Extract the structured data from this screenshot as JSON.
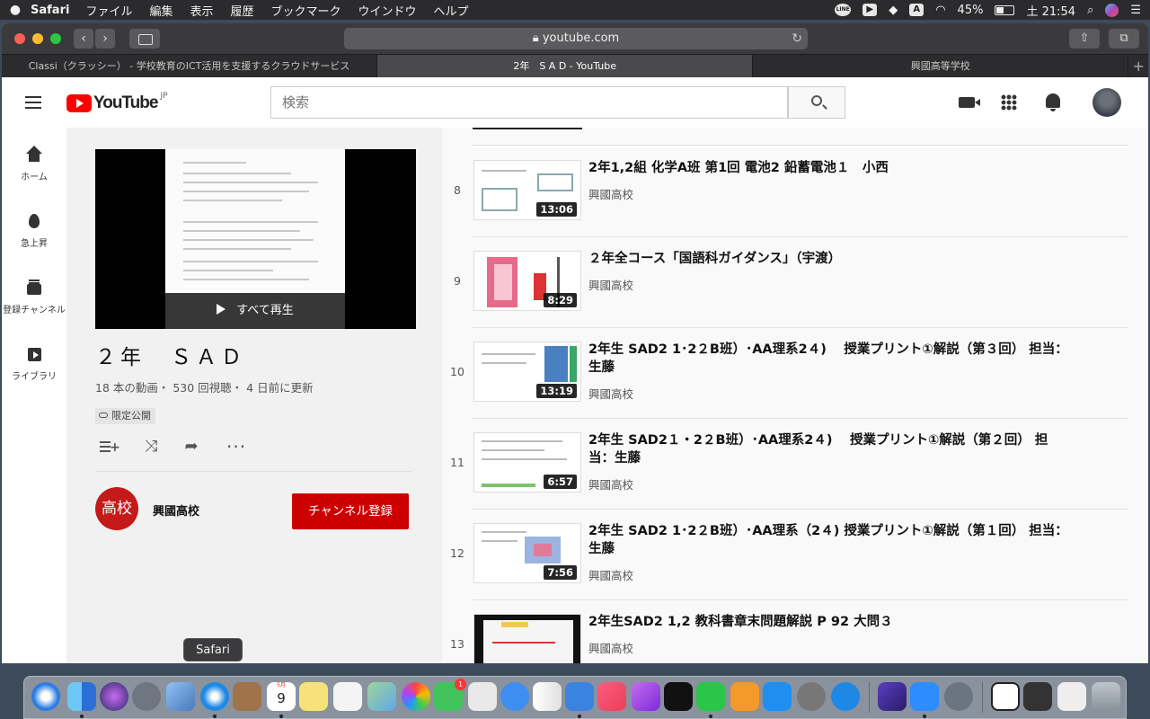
{
  "menubar": {
    "app_name": "Safari",
    "items": [
      "ファイル",
      "編集",
      "表示",
      "履歴",
      "ブックマーク",
      "ウインドウ",
      "ヘルプ"
    ],
    "status": {
      "line": "LINE",
      "a_label": "A",
      "battery": "45%",
      "battery_level": 0.45,
      "clock": "土 21:54"
    }
  },
  "browser": {
    "url": "youtube.com",
    "tabs": [
      {
        "label": "Classi（クラッシー） - 学校教育のICT活用を支援するクラウドサービス",
        "active": false
      },
      {
        "label": "2年　S A D - YouTube",
        "active": true
      },
      {
        "label": "興國高等学校",
        "active": false
      }
    ],
    "new_tab": "+"
  },
  "youtube": {
    "logo_text": "YouTube",
    "region": "JP",
    "search_placeholder": "検索",
    "guide": [
      {
        "label": "ホーム",
        "icon": "home-icon"
      },
      {
        "label": "急上昇",
        "icon": "fire-icon"
      },
      {
        "label": "登録チャンネル",
        "icon": "subscriptions-icon"
      },
      {
        "label": "ライブラリ",
        "icon": "library-icon"
      }
    ]
  },
  "playlist": {
    "play_all": "すべて再生",
    "title": "２年　ＳＡＤ",
    "stats": "18 本の動画・ 530 回視聴・ 4 日前に更新",
    "visibility": "限定公開",
    "owner_avatar_text": "高校",
    "owner": "興國高校",
    "subscribe": "チャンネル登録"
  },
  "videos": [
    {
      "index": "8",
      "title": "2年1,2組 化学A班 第1回 電池2 鉛蓄電池１　小西",
      "channel": "興國高校",
      "duration": "13:06"
    },
    {
      "index": "9",
      "title": "２年全コース「国語科ガイダンス」（宇渡）",
      "channel": "興國高校",
      "duration": "8:29"
    },
    {
      "index": "10",
      "title": "2年生 SAD2 1･2２B班）･AA理系2４)　 授業プリント①解説（第３回） 担当：生藤",
      "channel": "興國高校",
      "duration": "13:19"
    },
    {
      "index": "11",
      "title": "2年生 SAD2１・2２B班）･AA理系2４)　  授業プリント①解説（第２回） 担当：生藤",
      "channel": "興國高校",
      "duration": "6:57"
    },
    {
      "index": "12",
      "title": "2年生 SAD2 1･2２B班）･AA理系（2４)  授業プリント①解説（第１回） 担当：生藤",
      "channel": "興國高校",
      "duration": "7:56"
    },
    {
      "index": "13",
      "title": "2年生SAD2 1,2 教科書章末問題解説 P 92 大問３",
      "channel": "興國高校",
      "duration": ""
    }
  ],
  "dock": {
    "tooltip": "Safari",
    "calendar_month": "5月",
    "calendar_day": "9",
    "facetime_badge": "1"
  }
}
